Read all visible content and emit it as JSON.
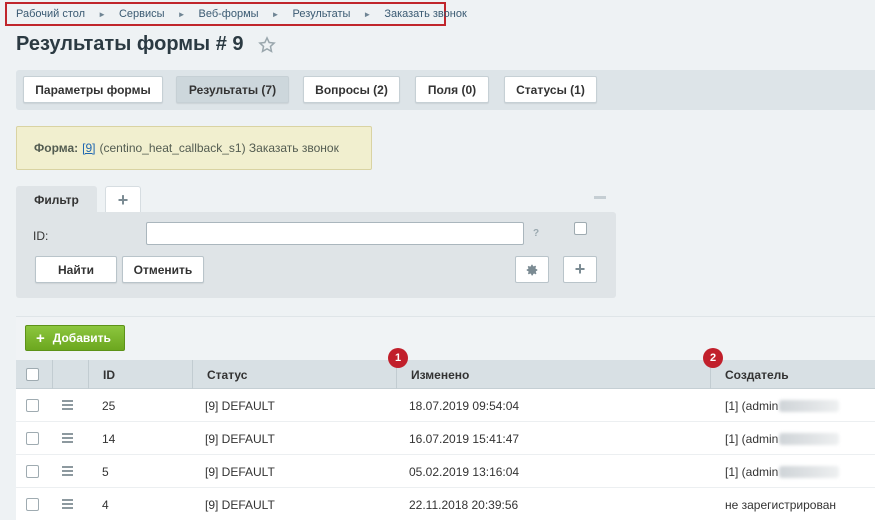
{
  "breadcrumb": [
    "Рабочий стол",
    "Сервисы",
    "Веб-формы",
    "Результаты",
    "Заказать звонок"
  ],
  "page_title": "Результаты формы # 9",
  "tabs": [
    {
      "label": "Параметры формы",
      "active": false
    },
    {
      "label": "Результаты (7)",
      "active": true
    },
    {
      "label": "Вопросы (2)",
      "active": false
    },
    {
      "label": "Поля (0)",
      "active": false
    },
    {
      "label": "Статусы (1)",
      "active": false
    }
  ],
  "form_note": {
    "prefix": "Форма:",
    "link": "[9]",
    "text": "(centino_heat_callback_s1) Заказать звонок"
  },
  "filter": {
    "tab_label": "Фильтр",
    "add_tab": "+",
    "field_label": "ID:",
    "field_value": "",
    "help": "?",
    "find_button": "Найти",
    "cancel_button": "Отменить",
    "add_button": "+"
  },
  "grid": {
    "add_button": "Добавить",
    "add_plus": "+",
    "columns": [
      "ID",
      "Статус",
      "Изменено",
      "Создатель"
    ],
    "badges": [
      "1",
      "2"
    ],
    "rows": [
      {
        "id": "25",
        "status": "[9] DEFAULT",
        "changed": "18.07.2019 09:54:04",
        "creator": "[1] (admin",
        "creator_blurred": true
      },
      {
        "id": "14",
        "status": "[9] DEFAULT",
        "changed": "16.07.2019 15:41:47",
        "creator": "[1] (admin",
        "creator_blurred": true
      },
      {
        "id": "5",
        "status": "[9] DEFAULT",
        "changed": "05.02.2019 13:16:04",
        "creator": "[1] (admin",
        "creator_blurred": true
      },
      {
        "id": "4",
        "status": "[9] DEFAULT",
        "changed": "22.11.2018 20:39:56",
        "creator": "не зарегистрирован",
        "creator_blurred": false
      }
    ]
  },
  "colors": {
    "accent_red": "#c11f2b",
    "add_green": "#7ab52e",
    "link_blue": "#2067b0"
  }
}
